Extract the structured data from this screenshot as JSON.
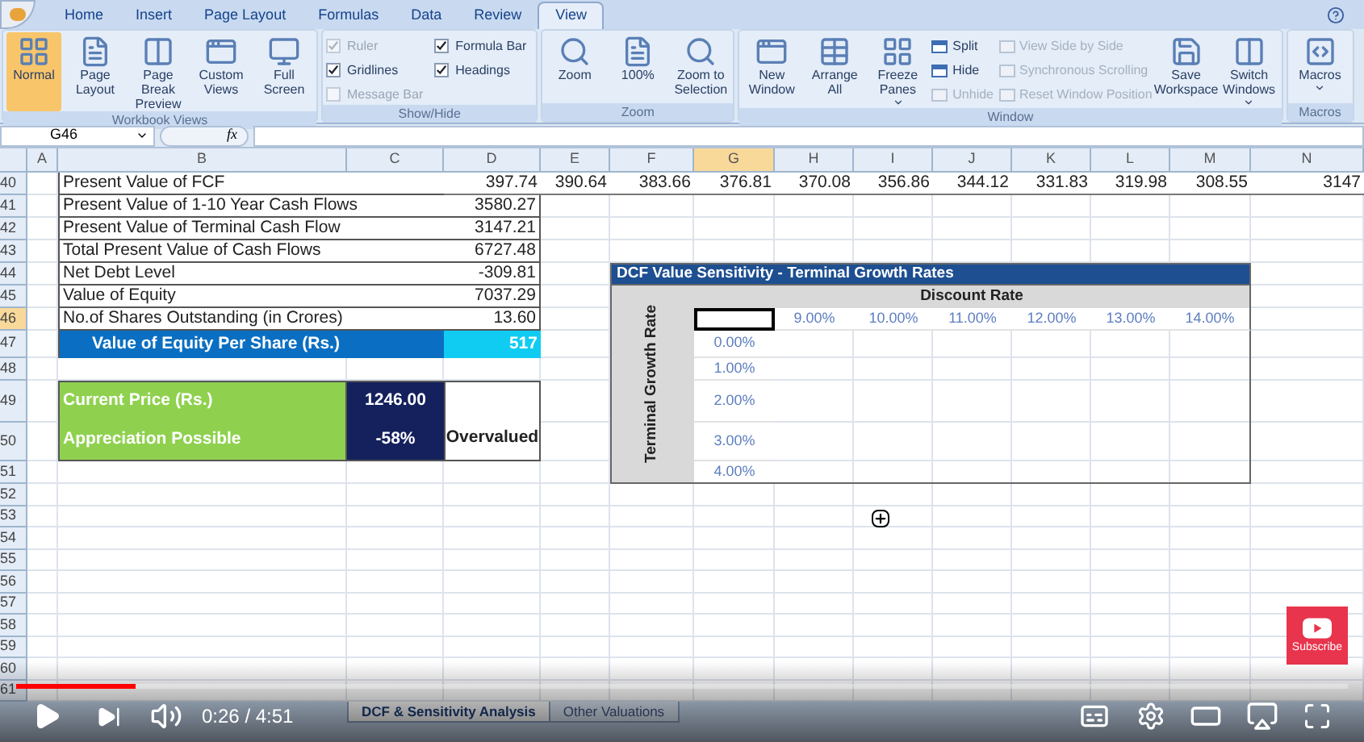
{
  "ribbon": {
    "tabs": [
      {
        "label": "Home",
        "selected": false
      },
      {
        "label": "Insert",
        "selected": false
      },
      {
        "label": "Page Layout",
        "selected": false
      },
      {
        "label": "Formulas",
        "selected": false
      },
      {
        "label": "Data",
        "selected": false
      },
      {
        "label": "Review",
        "selected": false
      },
      {
        "label": "View",
        "selected": true
      }
    ],
    "groups": [
      {
        "label": "Workbook Views",
        "items": [
          {
            "kind": "large",
            "label": "Normal",
            "selected": true,
            "dropdown": false
          },
          {
            "kind": "large",
            "label": "Page Layout",
            "selected": false,
            "dropdown": false
          },
          {
            "kind": "large",
            "label": "Page Break Preview",
            "selected": false,
            "dropdown": false
          },
          {
            "kind": "large",
            "label": "Custom Views",
            "selected": false,
            "dropdown": false
          },
          {
            "kind": "large",
            "label": "Full Screen",
            "selected": false,
            "dropdown": false
          }
        ]
      },
      {
        "label": "Show/Hide",
        "items": [
          {
            "kind": "check",
            "label": "Ruler",
            "checked": true,
            "disabled": true
          },
          {
            "kind": "check",
            "label": "Gridlines",
            "checked": true,
            "disabled": false
          },
          {
            "kind": "check",
            "label": "Message Bar",
            "checked": false,
            "disabled": true
          },
          {
            "kind": "check",
            "label": "Formula Bar",
            "checked": true,
            "disabled": false
          },
          {
            "kind": "check",
            "label": "Headings",
            "checked": true,
            "disabled": false
          }
        ]
      },
      {
        "label": "Zoom",
        "items": [
          {
            "kind": "large",
            "label": "Zoom",
            "dropdown": false
          },
          {
            "kind": "large",
            "label": "100%",
            "dropdown": false
          },
          {
            "kind": "large",
            "label": "Zoom to Selection",
            "dropdown": false
          }
        ]
      },
      {
        "label": "Window",
        "items": [
          {
            "kind": "large",
            "label": "New Window",
            "dropdown": false
          },
          {
            "kind": "large",
            "label": "Arrange All",
            "dropdown": false
          },
          {
            "kind": "large",
            "label": "Freeze Panes",
            "dropdown": true
          },
          {
            "kind": "small",
            "label": "Split",
            "disabled": false
          },
          {
            "kind": "small",
            "label": "Hide",
            "disabled": false
          },
          {
            "kind": "small",
            "label": "Unhide",
            "disabled": true
          },
          {
            "kind": "small",
            "label": "View Side by Side",
            "disabled": true
          },
          {
            "kind": "small",
            "label": "Synchronous Scrolling",
            "disabled": true
          },
          {
            "kind": "small",
            "label": "Reset Window Position",
            "disabled": true
          },
          {
            "kind": "large",
            "label": "Save Workspace",
            "dropdown": false
          },
          {
            "kind": "large",
            "label": "Switch Windows",
            "dropdown": true
          }
        ]
      },
      {
        "label": "Macros",
        "items": [
          {
            "kind": "large",
            "label": "Macros",
            "dropdown": true
          }
        ]
      }
    ]
  },
  "formula_bar": {
    "name_box": "G46",
    "fx": "fx"
  },
  "columns": [
    {
      "label": "A",
      "selected": false
    },
    {
      "label": "B",
      "selected": false
    },
    {
      "label": "C",
      "selected": false
    },
    {
      "label": "D",
      "selected": false
    },
    {
      "label": "E",
      "selected": false
    },
    {
      "label": "F",
      "selected": false
    },
    {
      "label": "G",
      "selected": true
    },
    {
      "label": "H",
      "selected": false
    },
    {
      "label": "I",
      "selected": false
    },
    {
      "label": "J",
      "selected": false
    },
    {
      "label": "K",
      "selected": false
    },
    {
      "label": "L",
      "selected": false
    },
    {
      "label": "M",
      "selected": false
    },
    {
      "label": "N",
      "selected": false
    }
  ],
  "rows": [
    {
      "label": "40",
      "selected": false
    },
    {
      "label": "41",
      "selected": false
    },
    {
      "label": "42",
      "selected": false
    },
    {
      "label": "43",
      "selected": false
    },
    {
      "label": "44",
      "selected": false
    },
    {
      "label": "45",
      "selected": false
    },
    {
      "label": "46",
      "selected": true
    },
    {
      "label": "47",
      "selected": false
    },
    {
      "label": "48",
      "selected": false
    },
    {
      "label": "49",
      "selected": false
    },
    {
      "label": "50",
      "selected": false
    },
    {
      "label": "51",
      "selected": false
    },
    {
      "label": "52",
      "selected": false
    },
    {
      "label": "53",
      "selected": false
    },
    {
      "label": "54",
      "selected": false
    },
    {
      "label": "55",
      "selected": false
    },
    {
      "label": "56",
      "selected": false
    },
    {
      "label": "57",
      "selected": false
    },
    {
      "label": "58",
      "selected": false
    },
    {
      "label": "59",
      "selected": false
    },
    {
      "label": "60",
      "selected": false
    },
    {
      "label": "61",
      "selected": false
    }
  ],
  "pv_fcf": {
    "label": "Present Value of FCF",
    "values": [
      "397.74",
      "390.64",
      "383.66",
      "376.81",
      "370.08",
      "356.86",
      "344.12",
      "331.83",
      "319.98",
      "308.55",
      "3147"
    ]
  },
  "summary": [
    {
      "label": "Present Value  of 1-10 Year Cash Flows",
      "value": "3580.27"
    },
    {
      "label": "Present Value of Terminal Cash Flow",
      "value": "3147.21"
    },
    {
      "label": "Total Present Value of Cash Flows",
      "value": "6727.48"
    },
    {
      "label": "Net Debt Level",
      "value": "-309.81"
    },
    {
      "label": "Value of Equity",
      "value": "7037.29"
    },
    {
      "label": "No.of Shares Outstanding (in Crores)",
      "value": "13.60"
    }
  ],
  "equity_per_share": {
    "label": "Value of Equity Per Share (Rs.)",
    "value": "517"
  },
  "price": [
    {
      "label": "Current Price (Rs.)",
      "value": "1246.00"
    },
    {
      "label": "Appreciation Possible",
      "value": "-58%"
    }
  ],
  "verdict": "Overvalued",
  "sensitivity": {
    "title": "DCF Value Sensitivity - Terminal Growth Rates",
    "column_axis": "Discount Rate",
    "row_axis": "Terminal Growth Rate",
    "discount_rates": [
      "9.00%",
      "10.00%",
      "11.00%",
      "12.00%",
      "13.00%",
      "14.00%"
    ],
    "growth_rates": [
      "0.00%",
      "1.00%",
      "2.00%",
      "3.00%",
      "4.00%"
    ]
  },
  "sheet_tabs": [
    {
      "label": "DCF & Sensitivity Analysis",
      "selected": true
    },
    {
      "label": "Other Valuations",
      "selected": false
    }
  ],
  "player": {
    "time": "0:26 / 4:51",
    "level": 0.09,
    "subscribe": "Subscribe"
  }
}
